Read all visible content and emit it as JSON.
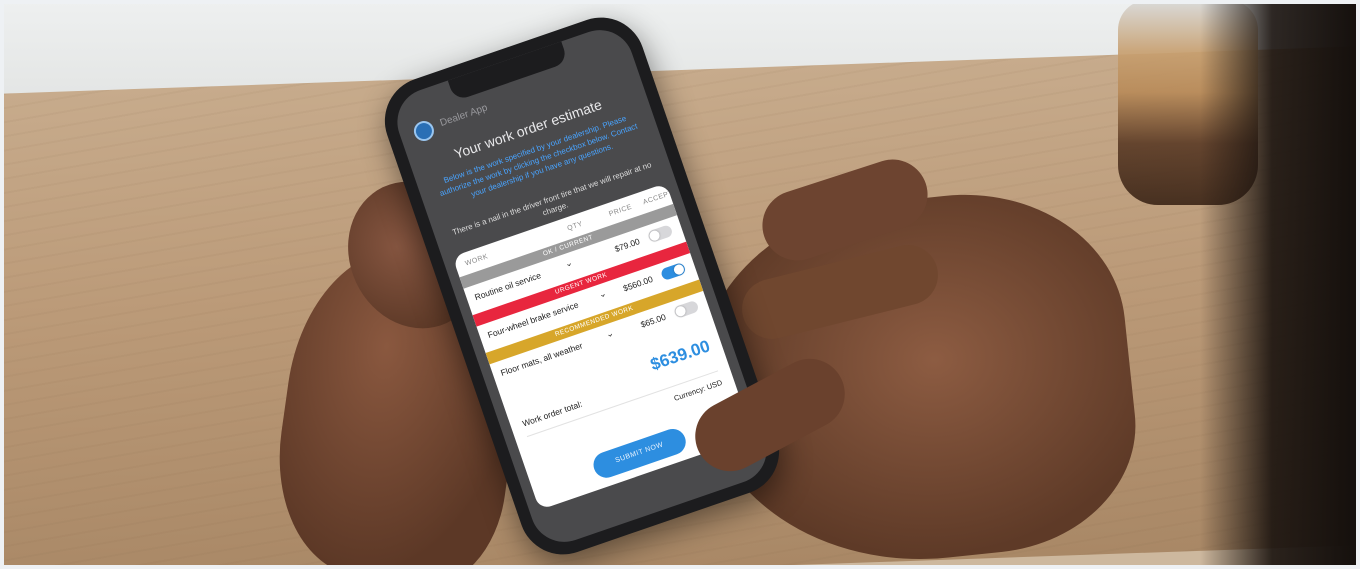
{
  "app": {
    "name": "Dealer App"
  },
  "estimate": {
    "title": "Your work order estimate",
    "blurb": "Below is the work specified by your dealership. Please authorize the work by clicking the checkbox below. Contact your dealership if you have any questions.",
    "note": "There is a nail in the driver front tire that we will repair at no charge."
  },
  "columns": {
    "work": "WORK",
    "qty": "QTY",
    "price": "PRICE",
    "accept": "ACCEPT"
  },
  "bands": {
    "ok": "OK / CURRENT",
    "urgent": "URGENT WORK",
    "recommended": "RECOMMENDED WORK"
  },
  "items": [
    {
      "label": "Routine oil service",
      "price": "$79.00",
      "accepted": false
    },
    {
      "label": "Four-wheel brake service",
      "price": "$560.00",
      "accepted": true
    },
    {
      "label": "Floor mats, all weather",
      "price": "$65.00",
      "accepted": false
    }
  ],
  "total": {
    "label": "Work order total:",
    "amount": "$639.00",
    "currency": "Currency: USD"
  },
  "submit_label": "SUBMIT NOW",
  "colors": {
    "accent": "#2d8ee0",
    "urgent": "#e8263e",
    "recommended": "#d7a62a",
    "ok": "#9a9a9a"
  }
}
